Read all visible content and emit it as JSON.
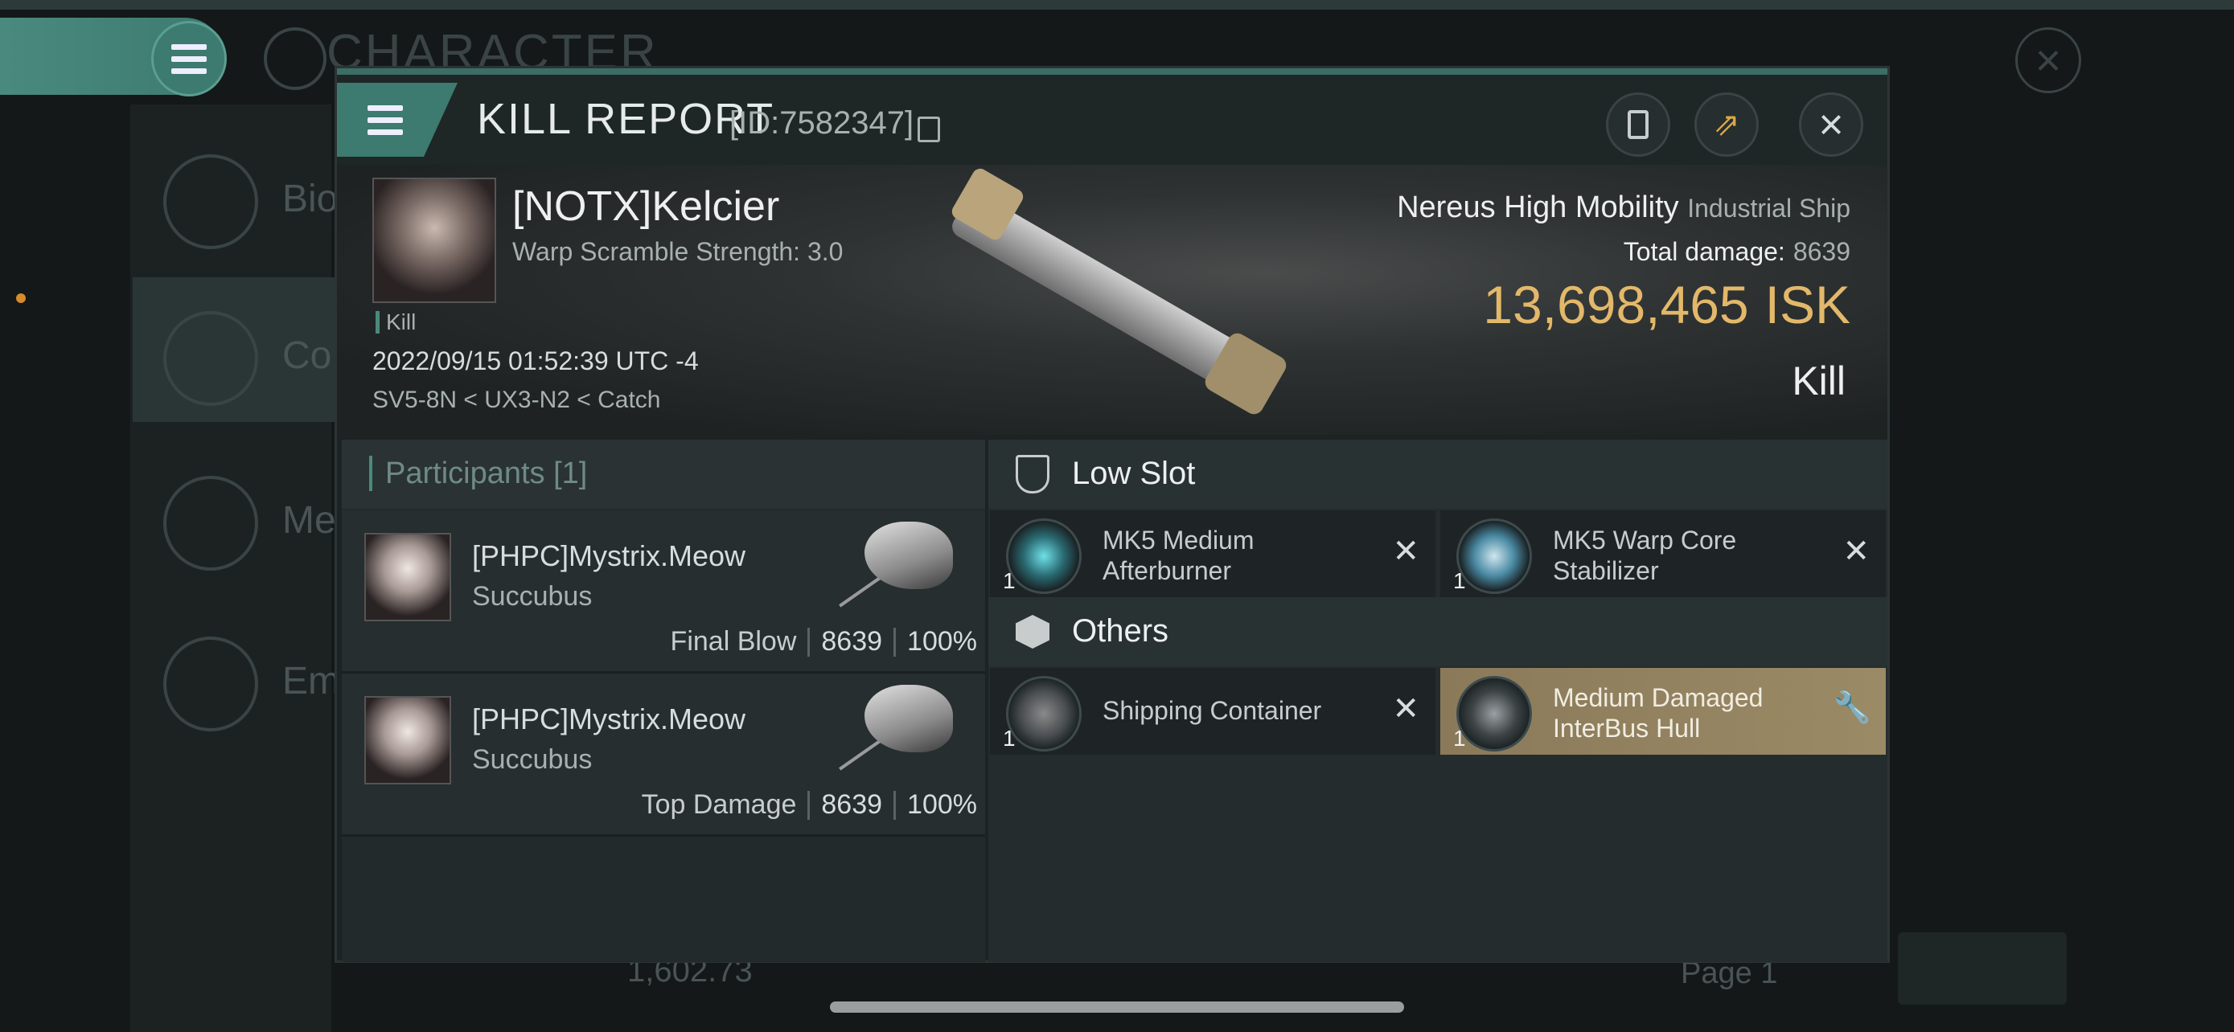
{
  "background": {
    "page_title": "CHARACTER",
    "sidebar_labels": [
      "Bio",
      "Co",
      "Me",
      "Em"
    ],
    "bottom_value": "1,602.73",
    "bottom_page": "Page 1"
  },
  "modal": {
    "title": "KILL REPORT",
    "id": "[ID:7582347]",
    "victim": {
      "name": "[NOTX]Kelcier",
      "warp_scramble": "Warp Scramble Strength: 3.0",
      "tag": "Kill",
      "datetime": "2022/09/15 01:52:39 UTC -4",
      "location": "SV5-8N < UX3-N2 < Catch"
    },
    "ship": {
      "name": "Nereus High Mobility",
      "class": "Industrial Ship",
      "total_damage_label": "Total damage:",
      "total_damage": "8639",
      "value": "13,698,465",
      "currency": "ISK",
      "result": "Kill"
    },
    "participants": {
      "title": "Participants [1]",
      "rows": [
        {
          "name": "[PHPC]Mystrix.Meow",
          "ship": "Succubus",
          "role": "Final Blow",
          "damage": "8639",
          "percent": "100%"
        },
        {
          "name": "[PHPC]Mystrix.Meow",
          "ship": "Succubus",
          "role": "Top Damage",
          "damage": "8639",
          "percent": "100%"
        }
      ]
    },
    "sections": [
      {
        "title": "Low Slot",
        "icon": "shield-icon",
        "items": [
          {
            "name": "MK5 Medium Afterburner",
            "qty": "1",
            "status": "destroyed"
          },
          {
            "name": "MK5 Warp Core Stabilizer",
            "qty": "1",
            "status": "destroyed"
          }
        ]
      },
      {
        "title": "Others",
        "icon": "cube-icon",
        "items": [
          {
            "name": "Shipping Container",
            "qty": "1",
            "status": "destroyed"
          },
          {
            "name": "Medium Damaged InterBus Hull",
            "qty": "1",
            "status": "dropped"
          }
        ]
      }
    ]
  },
  "colors": {
    "accent": "#3d7a70",
    "isk_gold": "#e3b86a",
    "dropped_item": "#9a8a65"
  }
}
